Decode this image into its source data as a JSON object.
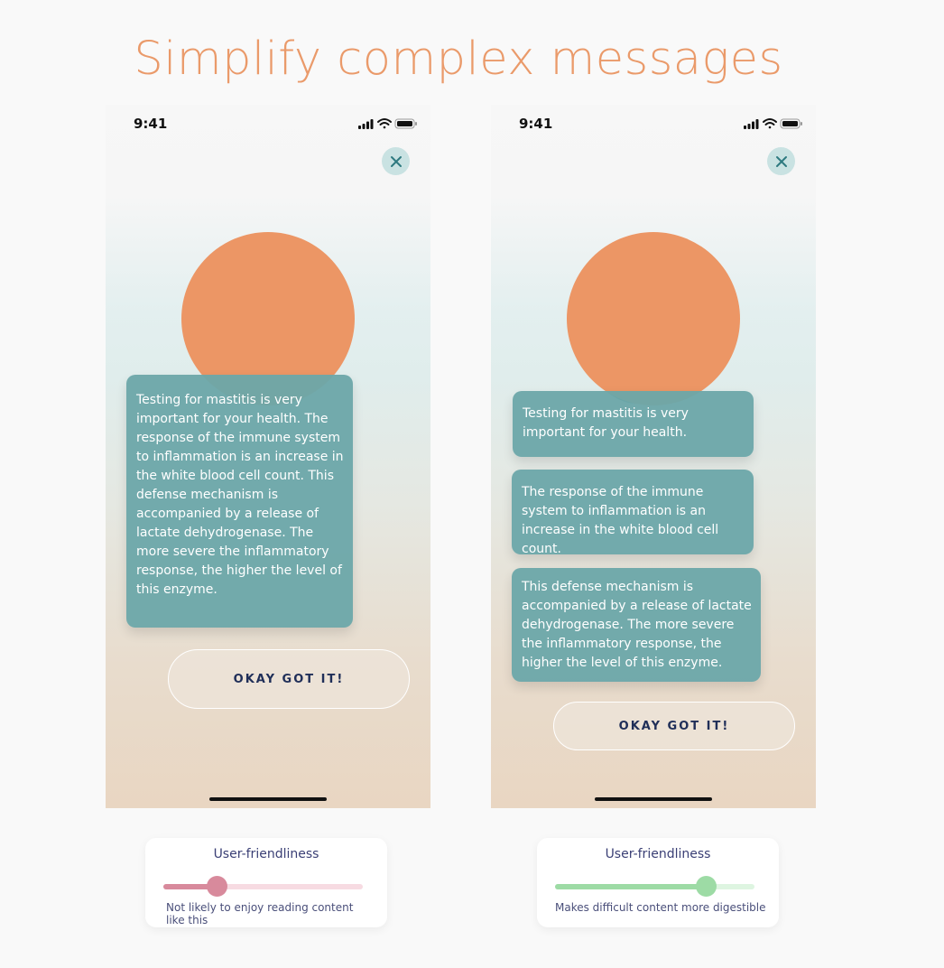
{
  "headline": "Simplify complex messages",
  "colors": {
    "headline": "#ea9a6a",
    "bubble": "#6ca6a9",
    "cta_text": "#1f2e58",
    "slider_negative": "#d88a9c",
    "slider_positive": "#9ddba5"
  },
  "phones": [
    {
      "status_time": "9:41",
      "bubbles": [
        "Testing for mastitis is very important for your health. The response of the immune system to inflammation is an increase in the white blood cell count. This defense mechanism is accompanied by a release of lactate dehydrogenase. The more severe the inflammatory response, the higher the level of this enzyme."
      ],
      "cta_label": "OKAY GOT IT!",
      "rating": {
        "title": "User-friendliness",
        "value": 0.27,
        "caption": "Not likely to enjoy reading content like this"
      }
    },
    {
      "status_time": "9:41",
      "bubbles": [
        "Testing for mastitis is very important for your health.",
        "The response of the immune system to inflammation is an increase in the white blood cell count.",
        "This defense mechanism is accompanied by a release of lactate dehydrogenase. The more severe the inflammatory response, the higher the level of this enzyme."
      ],
      "cta_label": "OKAY GOT IT!",
      "rating": {
        "title": "User-friendliness",
        "value": 0.76,
        "caption": "Makes difficult content more digestible"
      }
    }
  ]
}
